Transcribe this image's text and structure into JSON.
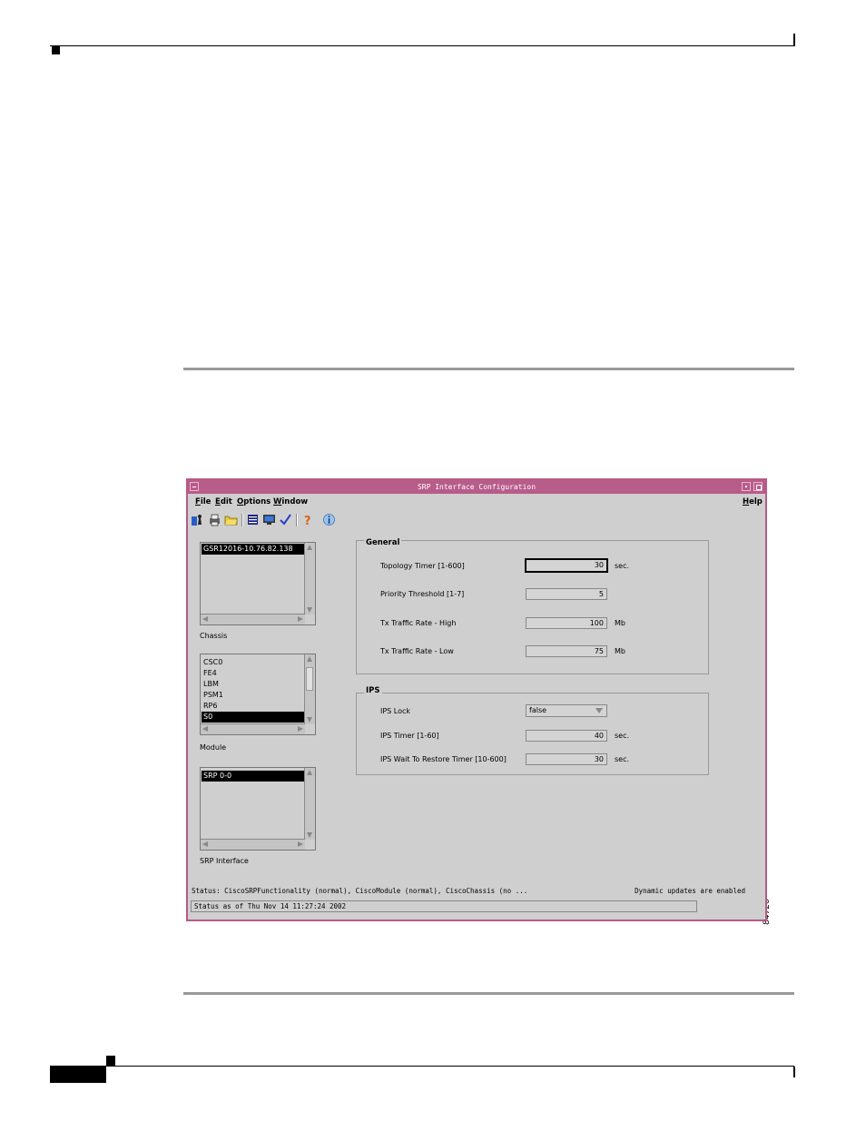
{
  "figure_number": "84726",
  "window": {
    "title": "SRP Interface Configuration"
  },
  "menubar": {
    "file": "File",
    "edit": "Edit",
    "options": "Options",
    "window": "Window",
    "help": "Help"
  },
  "toolbar": {
    "icons": [
      "open-icon",
      "print-icon",
      "folder-icon",
      "list-icon",
      "monitor-icon",
      "check-icon",
      "help-icon",
      "info-icon"
    ]
  },
  "chassis": {
    "label": "Chassis",
    "items": [
      "GSR12016-10.76.82.138"
    ],
    "selected": 0
  },
  "module": {
    "label": "Module",
    "items": [
      "CSC0",
      "FE4",
      "LBM",
      "PSM1",
      "RP6",
      "S0"
    ],
    "selected": 5
  },
  "srp_interface": {
    "label": "SRP Interface",
    "items": [
      "SRP 0-0"
    ],
    "selected": 0
  },
  "general": {
    "title": "General",
    "topology_timer": {
      "label": "Topology Timer [1-600]",
      "value": "30",
      "unit": "sec."
    },
    "priority_threshold": {
      "label": "Priority Threshold [1-7]",
      "value": "5"
    },
    "tx_high": {
      "label": "Tx Traffic Rate - High",
      "value": "100",
      "unit": "Mb"
    },
    "tx_low": {
      "label": "Tx Traffic Rate - Low",
      "value": "75",
      "unit": "Mb"
    }
  },
  "ips": {
    "title": "IPS",
    "lock": {
      "label": "IPS Lock",
      "value": "false"
    },
    "timer": {
      "label": "IPS Timer [1-60]",
      "value": "40",
      "unit": "sec."
    },
    "wtr": {
      "label": "IPS Wait To Restore Timer [10-600]",
      "value": "30",
      "unit": "sec."
    }
  },
  "status": {
    "line1": "Status: CiscoSRPFunctionality (normal), CiscoModule (normal), CiscoChassis (no ...",
    "dynamic": "Dynamic updates are enabled",
    "line2": "Status as of Thu Nov 14 11:27:24 2002"
  }
}
